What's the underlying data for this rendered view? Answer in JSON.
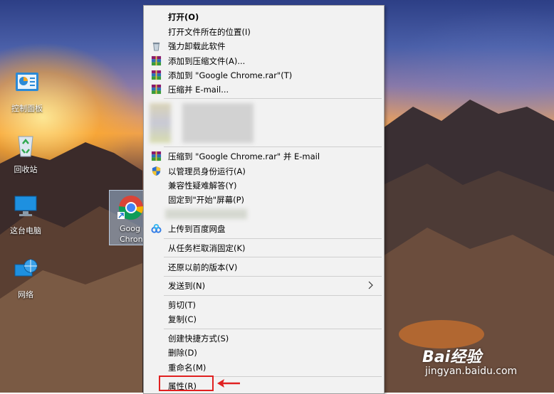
{
  "desktop": {
    "icons": [
      {
        "label": "控制面板",
        "icon": "control-panel-icon"
      },
      {
        "label": "回收站",
        "icon": "recycle-bin-icon"
      },
      {
        "label": "这台电脑",
        "icon": "this-pc-icon"
      },
      {
        "label": "网络",
        "icon": "network-icon"
      }
    ],
    "selected_icon": {
      "line1": "Goog",
      "line2": "Chron",
      "icon": "chrome-icon"
    }
  },
  "context_menu": {
    "items": [
      {
        "label": "打开(O)",
        "bold": true
      },
      {
        "label": "打开文件所在的位置(I)"
      },
      {
        "label": "强力卸载此软件",
        "icon": "trash-icon"
      },
      {
        "label": "添加到压缩文件(A)...",
        "icon": "winrar-icon"
      },
      {
        "label": "添加到 \"Google Chrome.rar\"(T)",
        "icon": "winrar-icon"
      },
      {
        "label": "压缩并 E-mail...",
        "icon": "winrar-icon"
      },
      {
        "label": "压缩到 \"Google Chrome.rar\" 并 E-mail",
        "icon": "winrar-icon"
      },
      {
        "label": "以管理员身份运行(A)",
        "icon": "shield-icon"
      },
      {
        "label": "兼容性疑难解答(Y)"
      },
      {
        "label": "固定到\"开始\"屏幕(P)"
      },
      {
        "label": "上传到百度网盘",
        "icon": "baidu-netdisk-icon"
      },
      {
        "label": "从任务栏取消固定(K)"
      },
      {
        "label": "还原以前的版本(V)"
      },
      {
        "label": "发送到(N)",
        "submenu": true
      },
      {
        "label": "剪切(T)"
      },
      {
        "label": "复制(C)"
      },
      {
        "label": "创建快捷方式(S)"
      },
      {
        "label": "删除(D)"
      },
      {
        "label": "重命名(M)"
      },
      {
        "label": "属性(R)"
      }
    ]
  },
  "watermark": {
    "brand": "Bai经验",
    "url": "jingyan.baidu.com"
  },
  "colors": {
    "menu_bg": "#f2f2f2",
    "highlight": "#e02020"
  }
}
